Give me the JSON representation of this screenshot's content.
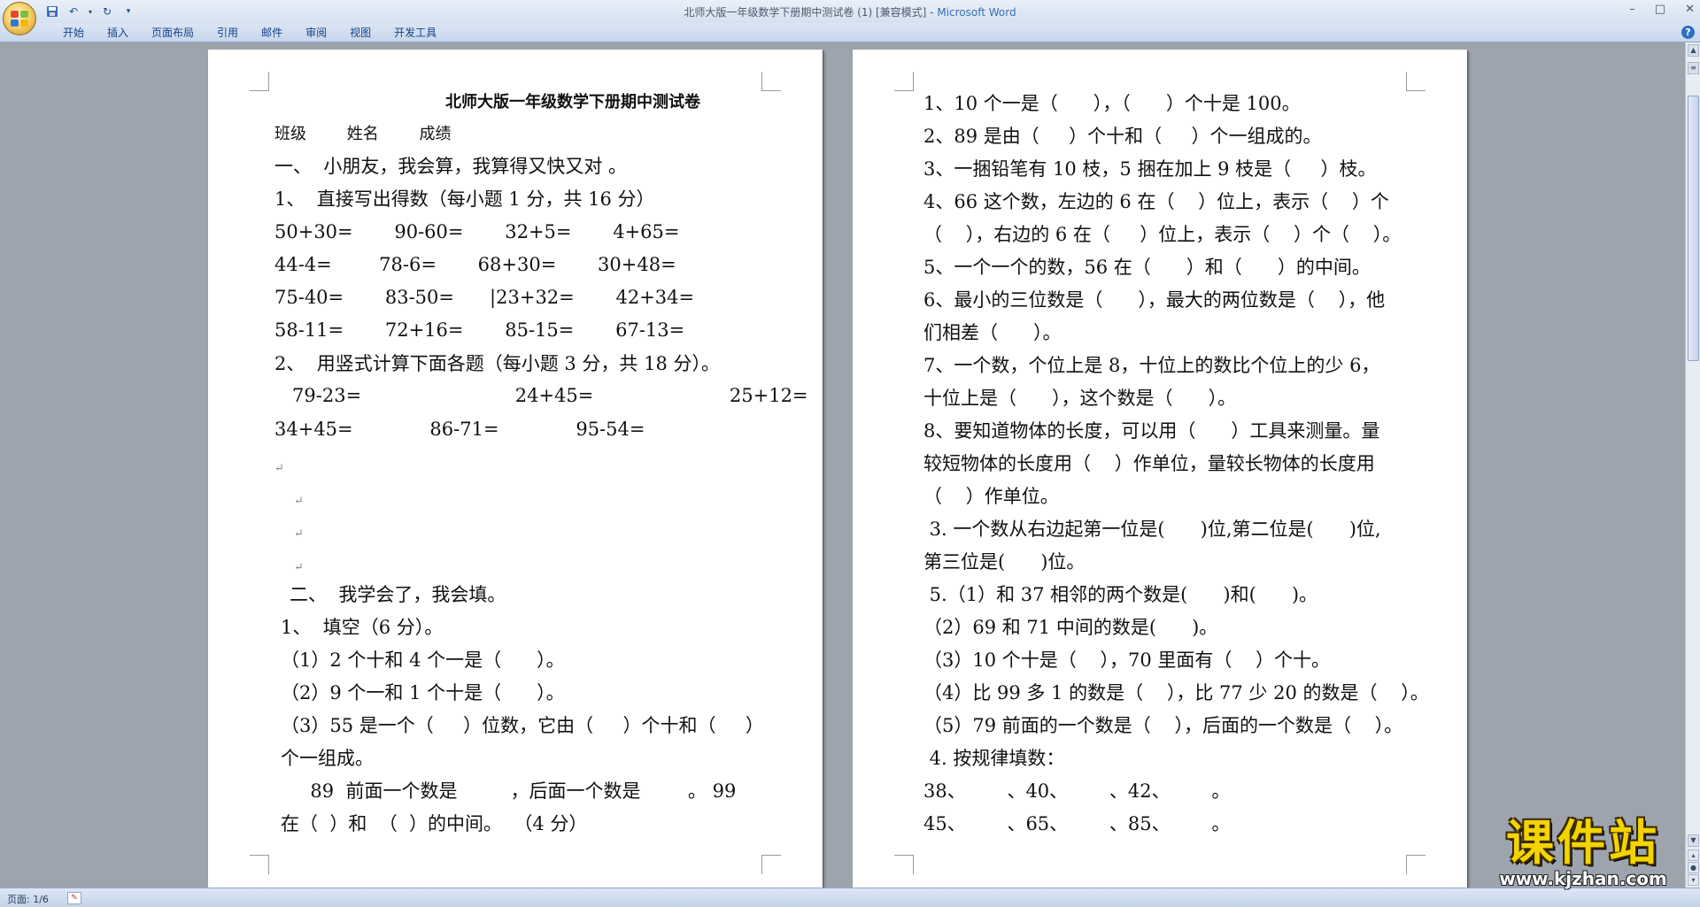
{
  "window": {
    "title": "北师大版一年级数学下册期中测试卷 (1) [兼容模式] - ",
    "app_name": "Microsoft Word"
  },
  "ribbon_tabs": [
    "开始",
    "插入",
    "页面布局",
    "引用",
    "邮件",
    "审阅",
    "视图",
    "开发工具"
  ],
  "quick_access": [
    "save-icon",
    "undo-icon",
    "redo-icon",
    "customize-icon"
  ],
  "colors": {
    "watermark_yellow": "#f4d400",
    "accent_blue": "#15428b"
  },
  "page_left": {
    "title": "北师大版一年级数学下册期中测试卷",
    "header_info": "班级        姓名        成绩",
    "lines": [
      "一、  小朋友，我会算，我算得又快又对 。",
      "1、  直接写出得数（每小题 1 分，共 16 分）",
      "50+30=       90-60=       32+5=       4+65=",
      "44-4=        78-6=       68+30=       30+48=",
      "75-40=       83-50=      |23+32=       42+34=",
      "58-11=       72+16=       85-15=       67-13=",
      "2、  用竖式计算下面各题（每小题 3 分，共 18 分）。",
      "   79-23=                          24+45=                       25+12=",
      "34+45=             86-71=             95-54=",
      "二、  我学会了，我会填。",
      "1、  填空（6 分）。",
      "（1）2 个十和 4 个一是（      ）。",
      "（2）9 个一和 1 个十是（      ）。",
      "（3）55 是一个（     ）位数，它由（     ）个十和（     ）",
      "个一组成。",
      "     89  前面一个数是         ，后面一个数是        。 99",
      "在（  ）和  （  ）的中间。  （4 分）"
    ]
  },
  "page_right": {
    "lines": [
      "1、10 个一是（      ），（      ）个十是 100。",
      "2、89 是由（     ）个十和（     ）个一组成的。",
      "3、一捆铅笔有 10 枝，5 捆在加上 9 枝是（     ）枝。",
      "4、66 这个数，左边的 6 在（    ）位上，表示（    ）个",
      "（    ），右边的 6 在（     ）位上，表示（    ）个（    ）。",
      "5、一个一个的数，56 在（      ）和（      ）的中间。",
      "6、最小的三位数是（      ），最大的两位数是（    ），他",
      "们相差（      ）。",
      "7、一个数，个位上是 8，十位上的数比个位上的少 6，",
      "十位上是（      ），这个数是（      ）。",
      "8、要知道物体的长度，可以用（      ）工具来测量。量",
      "较短物体的长度用（    ）作单位，量较长物体的长度用",
      "（    ）作单位。",
      " 3. 一个数从右边起第一位是(      )位,第二位是(      )位,",
      "第三位是(      )位。",
      " 5.（1）和 37 相邻的两个数是(      )和(      )。",
      "（2）69 和 71 中间的数是(      )。",
      "（3）10 个十是（    ），70 里面有（    ）个十。",
      "（4）比 99 多 1 的数是（    ），比 77 少 20 的数是（    ）。",
      "（5）79 前面的一个数是（    ），后面的一个数是（    ）。",
      " 4. 按规律填数：",
      "38、       、40、       、42、       。",
      "45、       、65、       、85、       。"
    ]
  },
  "status": {
    "page": "页面: 1/6"
  },
  "watermark": {
    "text": "课件站",
    "url": "www.kjzhan.com"
  }
}
